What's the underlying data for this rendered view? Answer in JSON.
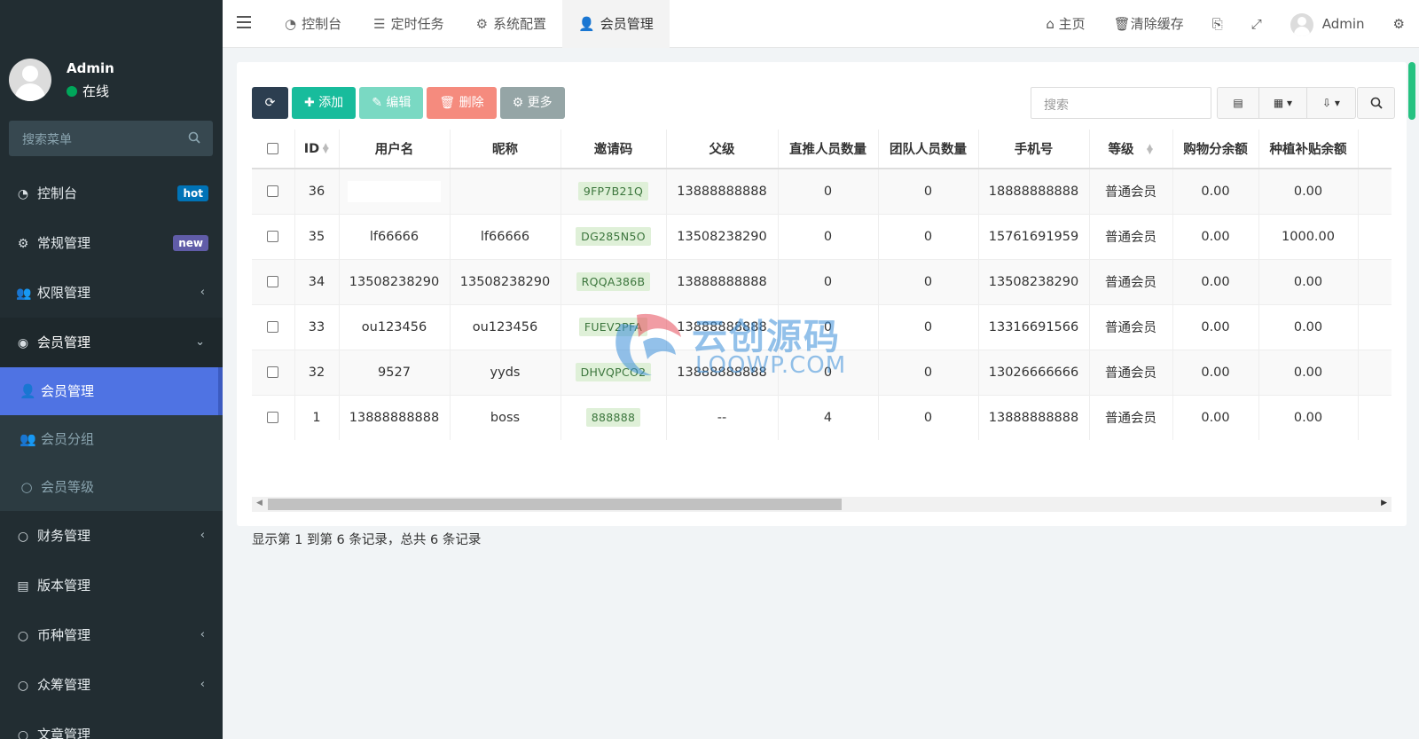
{
  "sidebar": {
    "user_name": "Admin",
    "user_status": "在线",
    "search_placeholder": "搜索菜单",
    "items": [
      {
        "label": "控制台",
        "icon": "dashboard-icon",
        "badge": "hot",
        "badge_color": "#0073b7"
      },
      {
        "label": "常规管理",
        "icon": "cogs-icon",
        "badge": "new",
        "badge_color": "#605ca8"
      },
      {
        "label": "权限管理",
        "icon": "users-icon"
      },
      {
        "label": "会员管理",
        "icon": "user-circle-icon",
        "expanded": true
      },
      {
        "label": "财务管理",
        "icon": "circle-icon"
      },
      {
        "label": "版本管理",
        "icon": "file-icon"
      },
      {
        "label": "币种管理",
        "icon": "circle-icon"
      },
      {
        "label": "众筹管理",
        "icon": "circle-icon"
      },
      {
        "label": "文章管理",
        "icon": "circle-icon"
      }
    ],
    "submenu": [
      {
        "label": "会员管理",
        "icon": "user-icon",
        "active": true
      },
      {
        "label": "会员分组",
        "icon": "users-icon"
      },
      {
        "label": "会员等级",
        "icon": "circle-icon"
      }
    ]
  },
  "topbar": {
    "tabs": [
      {
        "label": "控制台",
        "icon": "dashboard-icon"
      },
      {
        "label": "定时任务",
        "icon": "tasks-icon"
      },
      {
        "label": "系统配置",
        "icon": "cog-icon"
      },
      {
        "label": "会员管理",
        "icon": "user-icon",
        "active": true
      }
    ],
    "home": "主页",
    "clear_cache": "清除缓存",
    "user": "Admin"
  },
  "toolbar": {
    "add": "添加",
    "edit": "编辑",
    "delete": "删除",
    "more": "更多",
    "search_placeholder": "搜索"
  },
  "table": {
    "headers": [
      "ID",
      "用户名",
      "昵称",
      "邀请码",
      "父级",
      "直推人员数量",
      "团队人员数量",
      "手机号",
      "等级",
      "购物分余额",
      "种植补贴余额"
    ],
    "rows": [
      {
        "id": "36",
        "username": "",
        "nickname": "",
        "code": "9FP7B21Q",
        "parent": "13888888888",
        "direct": "0",
        "team": "0",
        "mobile": "18888888888",
        "level": "普通会员",
        "shop": "0.00",
        "plant": "0.00"
      },
      {
        "id": "35",
        "username": "lf66666",
        "nickname": "lf66666",
        "code": "DG285N5O",
        "parent": "13508238290",
        "direct": "0",
        "team": "0",
        "mobile": "15761691959",
        "level": "普通会员",
        "shop": "0.00",
        "plant": "1000.00"
      },
      {
        "id": "34",
        "username": "13508238290",
        "nickname": "13508238290",
        "code": "RQQA386B",
        "parent": "13888888888",
        "direct": "0",
        "team": "0",
        "mobile": "13508238290",
        "level": "普通会员",
        "shop": "0.00",
        "plant": "0.00"
      },
      {
        "id": "33",
        "username": "ou123456",
        "nickname": "ou123456",
        "code": "FUEV2PFA",
        "parent": "13888888888",
        "direct": "0",
        "team": "0",
        "mobile": "13316691566",
        "level": "普通会员",
        "shop": "0.00",
        "plant": "0.00"
      },
      {
        "id": "32",
        "username": "9527",
        "nickname": "yyds",
        "code": "DHVQPCO2",
        "parent": "13888888888",
        "direct": "0",
        "team": "0",
        "mobile": "13026666666",
        "level": "普通会员",
        "shop": "0.00",
        "plant": "0.00"
      },
      {
        "id": "1",
        "username": "13888888888",
        "nickname": "boss",
        "code": "888888",
        "parent": "--",
        "direct": "4",
        "team": "0",
        "mobile": "13888888888",
        "level": "普通会员",
        "shop": "0.00",
        "plant": "0.00"
      }
    ]
  },
  "footer": {
    "info": "显示第 1 到第 6 条记录，总共 6 条记录"
  },
  "watermark": {
    "title": "云创源码",
    "subtitle": "LOOWP.COM"
  }
}
